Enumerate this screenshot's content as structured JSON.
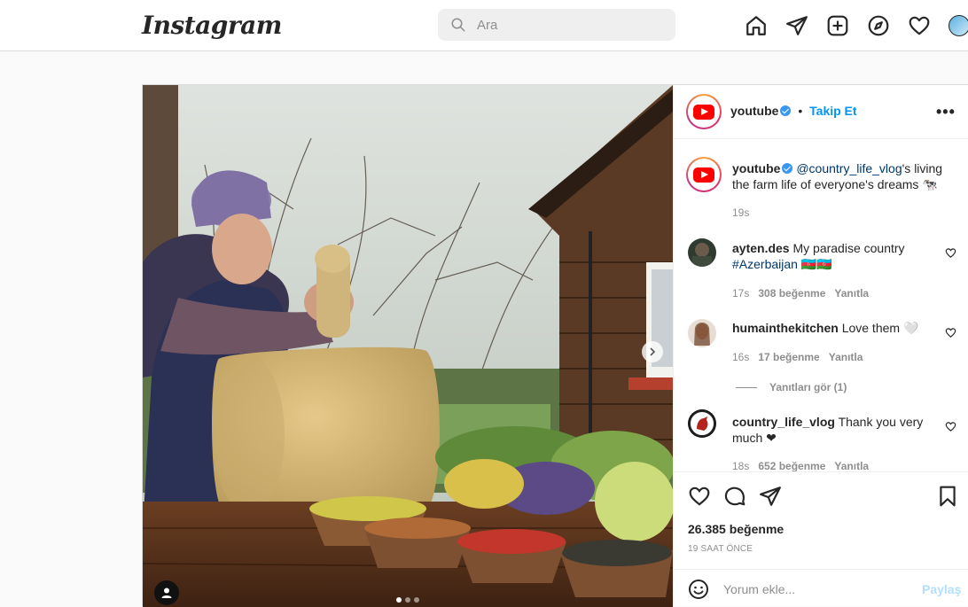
{
  "header": {
    "logo": "Instagram",
    "search_placeholder": "Ara",
    "icons": [
      "home-icon",
      "direct-icon",
      "new-post-icon",
      "explore-icon",
      "activity-heart-icon",
      "profile-avatar"
    ]
  },
  "post": {
    "author": "youtube",
    "follow_label": "Takip Et",
    "separator": "•",
    "more_label": "•••",
    "caption": {
      "user": "youtube",
      "mention": "@country_life_vlog",
      "text": "'s living the farm life of everyone's dreams 🐄",
      "time": "19s"
    },
    "comments": [
      {
        "user": "ayten.des",
        "text": "My paradise country",
        "hashtag": "#Azerbaijan",
        "emoji": "🇦🇿🇦🇿",
        "time": "17s",
        "likes": "308 beğenme",
        "reply": "Yanıtla"
      },
      {
        "user": "humainthekitchen",
        "text": "Love them 🤍",
        "time": "16s",
        "likes": "17 beğenme",
        "reply": "Yanıtla",
        "view_replies": "Yanıtları gör (1)"
      },
      {
        "user": "country_life_vlog",
        "text": "Thank you very much ❤",
        "time": "18s",
        "likes": "652 beğenme",
        "reply": "Yanıtla"
      }
    ],
    "likes": "26.385 beğenme",
    "posted": "19 SAAT ÖNCE",
    "comment_placeholder": "Yorum ekle...",
    "post_label": "Paylaş"
  },
  "colors": {
    "accent": "#0095f6",
    "text": "#262626",
    "muted": "#8e8e8e",
    "youtube": "#ff0000"
  }
}
